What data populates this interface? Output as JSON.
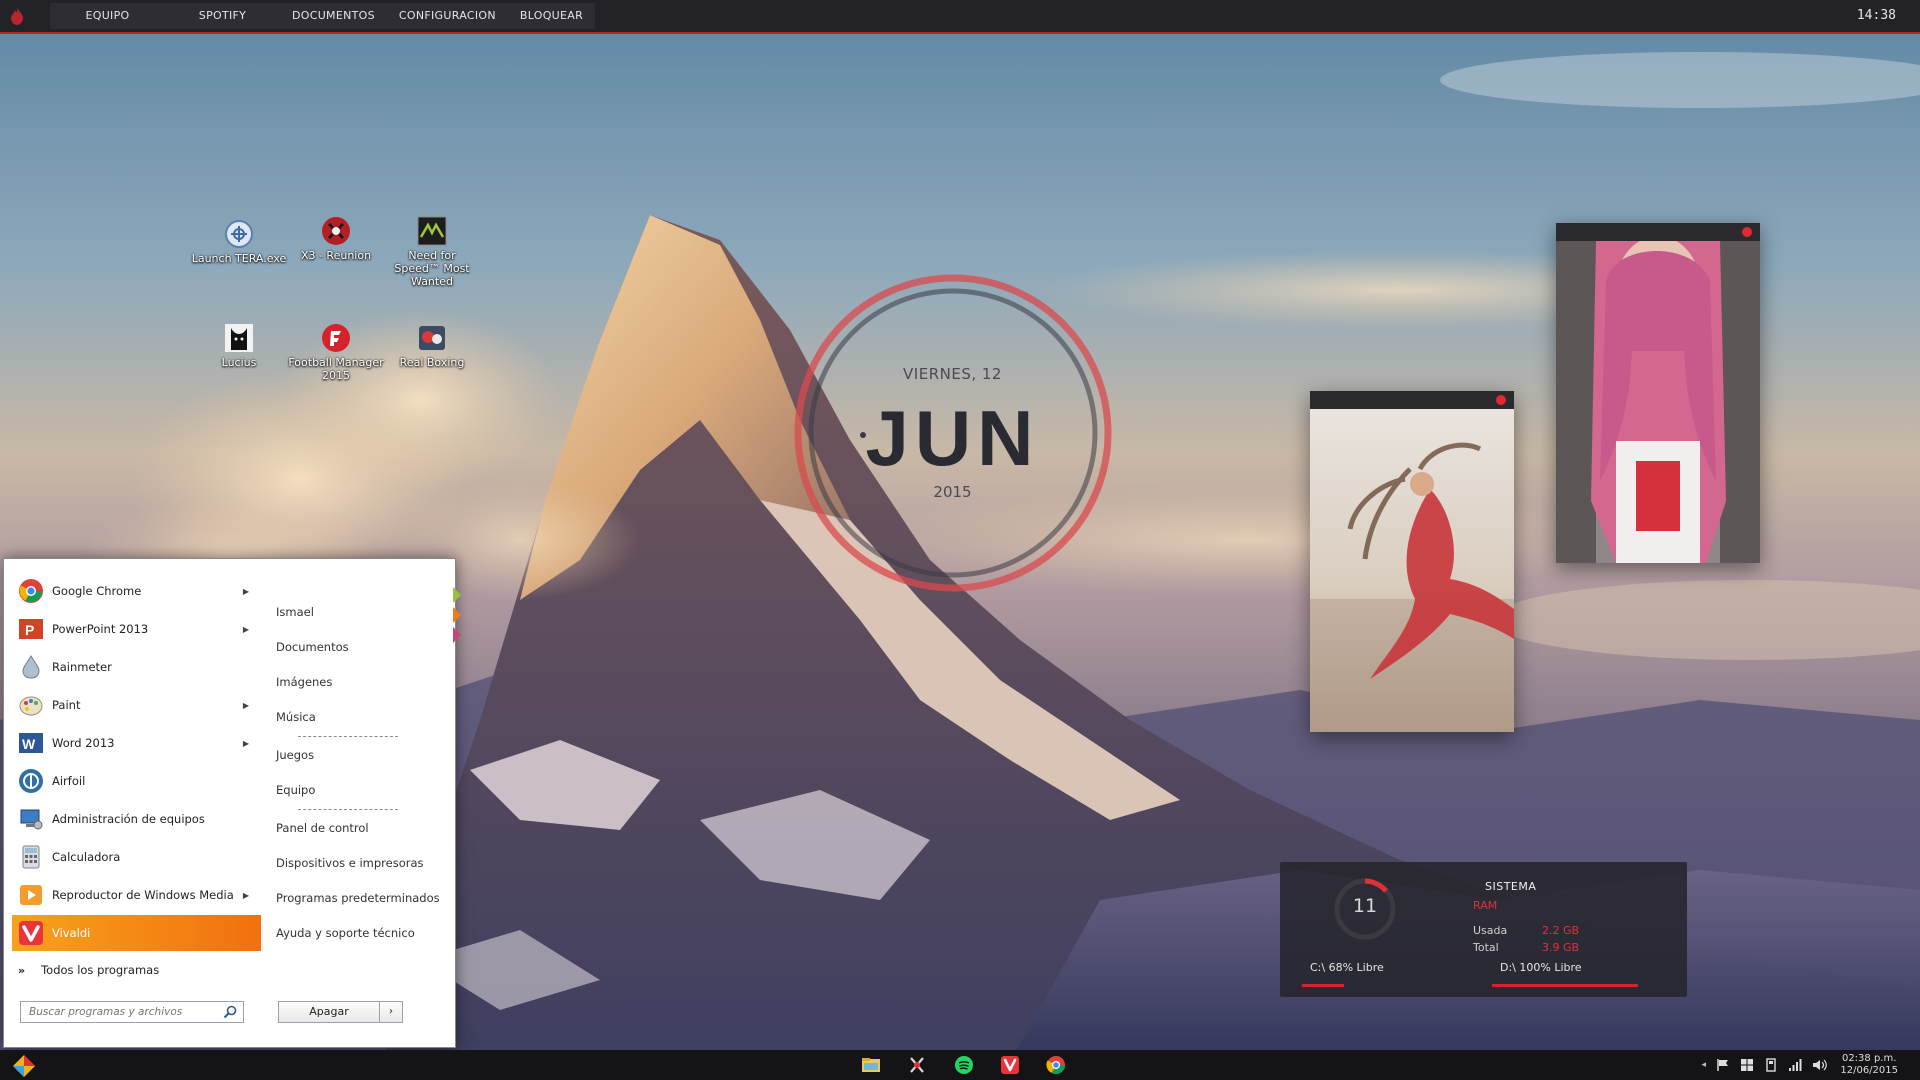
{
  "topbar": {
    "menu": [
      "EQUIPO",
      "SPOTIFY",
      "DOCUMENTOS",
      "CONFIGURACION",
      "BLOQUEAR"
    ],
    "clock": "14:38"
  },
  "desktop_icons": [
    {
      "label": "Launch TERA.exe"
    },
    {
      "label": "X3 - Reunion"
    },
    {
      "label": "Need for Speed™ Most Wanted"
    },
    {
      "label": "Lucius"
    },
    {
      "label": "Football Manager 2015"
    },
    {
      "label": "Real Boxing"
    }
  ],
  "date_widget": {
    "day": "VIERNES, 12",
    "month": "JUN",
    "year": "2015"
  },
  "system_widget": {
    "title": "SISTEMA",
    "ram_label": "RAM",
    "used_label": "Usada",
    "used_value": "2.2 GB",
    "total_label": "Total",
    "total_value": "3.9 GB",
    "cpu_value": "11",
    "drive_c": "C:\\ 68% Libre",
    "drive_d": "D:\\ 100% Libre"
  },
  "start_menu": {
    "programs": [
      {
        "label": "Google Chrome",
        "has_arrow": true
      },
      {
        "label": "PowerPoint 2013",
        "has_arrow": true
      },
      {
        "label": "Rainmeter",
        "has_arrow": false
      },
      {
        "label": "Paint",
        "has_arrow": true
      },
      {
        "label": "Word 2013",
        "has_arrow": true
      },
      {
        "label": "Airfoil",
        "has_arrow": false
      },
      {
        "label": "Administración de equipos",
        "has_arrow": false
      },
      {
        "label": "Calculadora",
        "has_arrow": false
      },
      {
        "label": "Reproductor de Windows Media",
        "has_arrow": true
      },
      {
        "label": "Vivaldi",
        "has_arrow": false
      }
    ],
    "all_programs": "Todos los programas",
    "search_placeholder": "Buscar programas y archivos",
    "places": [
      "Ismael",
      "Documentos",
      "Imágenes",
      "Música",
      "Juegos",
      "Equipo",
      "Panel de control",
      "Dispositivos e impresoras",
      "Programas predeterminados",
      "Ayuda y soporte técnico"
    ],
    "shutdown": "Apagar",
    "shutdown_arrow": "›"
  },
  "taskbar": {
    "time": "02:38 p.m.",
    "date": "12/06/2015"
  },
  "colors": {
    "accent": "#e0313a",
    "topbar": "#232327",
    "active_item": "#f2700f"
  }
}
